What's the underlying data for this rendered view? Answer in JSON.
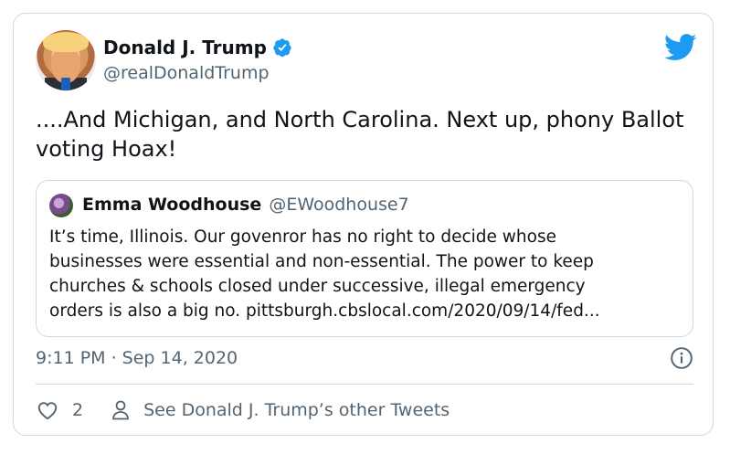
{
  "author": {
    "name": "Donald J. Trump",
    "handle": "@realDonaldTrump",
    "verified": true
  },
  "tweet": {
    "text": "....And Michigan, and North Carolina. Next up, phony Ballot voting Hoax!",
    "timestamp": "9:11 PM · Sep 14, 2020",
    "like_count": "2",
    "see_other_label": "See Donald J. Trump’s other Tweets"
  },
  "quoted_tweet": {
    "name": "Emma Woodhouse",
    "handle": "@EWoodhouse7",
    "text": "It’s time, Illinois. Our govenror has no right to decide whose\nbusinesses were essential and non-essential. The power to keep\nchurches & schools closed under successive, illegal emergency\norders is also a big no. pittsburgh.cbslocal.com/2020/09/14/fed..."
  },
  "icons": {
    "brand": "twitter-bird-icon",
    "verified": "verified-badge-icon",
    "info": "info-icon",
    "like": "heart-icon",
    "profile": "person-icon"
  },
  "colors": {
    "twitter_blue": "#1d9bf0",
    "secondary_text": "#536471",
    "border": "#cfd9de"
  }
}
